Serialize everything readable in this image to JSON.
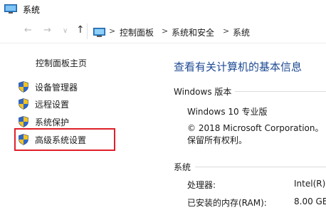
{
  "window": {
    "title": "系统"
  },
  "nav": {
    "back": "←",
    "forward": "→",
    "recent": "∨",
    "up": "↑",
    "breadcrumb": [
      "控制面板",
      "系统和安全",
      "系统"
    ],
    "separator": ">"
  },
  "sidebar": {
    "home": "控制面板主页",
    "items": [
      {
        "label": "设备管理器",
        "icon": "shield-icon"
      },
      {
        "label": "远程设置",
        "icon": "shield-icon"
      },
      {
        "label": "系统保护",
        "icon": "shield-icon"
      },
      {
        "label": "高级系统设置",
        "icon": "shield-icon",
        "highlighted": true
      }
    ]
  },
  "main": {
    "title": "查看有关计算机的基本信息",
    "windows_section": {
      "label": "Windows 版本",
      "edition": "Windows 10 专业版",
      "copyright": "© 2018 Microsoft Corporation。",
      "rights": "保留所有权利。"
    },
    "system_section": {
      "label": "系统",
      "processor_label": "处理器:",
      "processor_value": "Intel(R)",
      "ram_label": "已安装的内存(RAM):",
      "ram_value": "8.00 GB"
    }
  },
  "colors": {
    "link_blue": "#1e4a94",
    "highlight_red": "#e0202a",
    "shield_blue": "#2f66c9",
    "shield_yellow": "#f2c320"
  }
}
